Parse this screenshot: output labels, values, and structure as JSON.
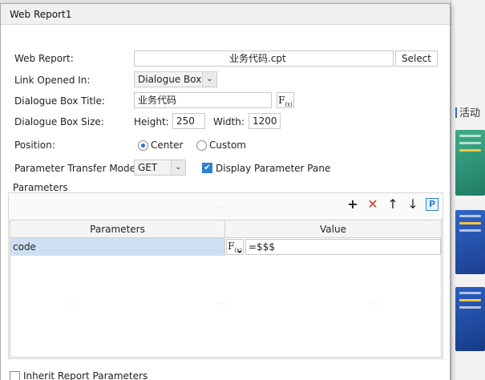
{
  "dialog": {
    "title": "Web Report1"
  },
  "web_report": {
    "label": "Web Report:",
    "value": "业务代码.cpt",
    "select_label": "Select"
  },
  "link_opened_in": {
    "label": "Link Opened In:",
    "value": "Dialogue Box"
  },
  "dialogue_box_title": {
    "label": "Dialogue Box Title:",
    "value": "业务代码"
  },
  "dialogue_box_size": {
    "label": "Dialogue Box Size:",
    "height_label": "Height:",
    "height_value": "250",
    "width_label": "Width:",
    "width_value": "1200"
  },
  "position": {
    "label": "Position:",
    "options": [
      "Center",
      "Custom"
    ],
    "selected": "Center"
  },
  "parameter_transfer_mode": {
    "label": "Parameter Transfer Mode:",
    "value": "GET",
    "display_parameter_pane_label": "Display Parameter Pane",
    "display_parameter_pane_checked": true
  },
  "parameters": {
    "group_title": "Parameters",
    "columns": [
      "Parameters",
      "Value"
    ],
    "rows": [
      {
        "name": "code",
        "value": "=$$$"
      }
    ]
  },
  "inherit_report_parameters": {
    "label": "Inherit Report Parameters",
    "checked": false
  },
  "background": {
    "side_label": "活动"
  },
  "colors": {
    "accent": "#2f7fd6",
    "selected_row": "#cddff0",
    "delete": "#e0372f"
  }
}
